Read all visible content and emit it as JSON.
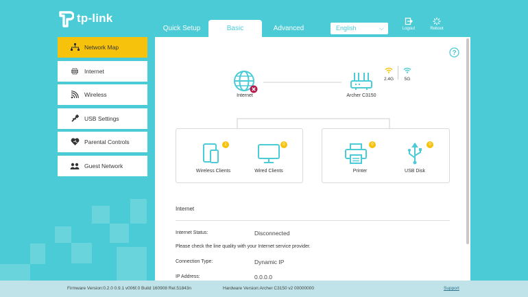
{
  "brand": {
    "name": "tp-link"
  },
  "tabs": [
    {
      "label": "Quick Setup"
    },
    {
      "label": "Basic"
    },
    {
      "label": "Advanced"
    }
  ],
  "language": {
    "selected": "English"
  },
  "top_buttons": {
    "logout": "Logout",
    "reboot": "Reboot"
  },
  "sidebar": {
    "items": [
      {
        "label": "Network Map",
        "icon": "network-map-icon"
      },
      {
        "label": "Internet",
        "icon": "globe-icon"
      },
      {
        "label": "Wireless",
        "icon": "wifi-icon"
      },
      {
        "label": "USB Settings",
        "icon": "usb-icon"
      },
      {
        "label": "Parental Controls",
        "icon": "heart-icon"
      },
      {
        "label": "Guest Network",
        "icon": "users-icon"
      }
    ]
  },
  "map": {
    "internet_label": "Internet",
    "router_label": "Archer C3150",
    "band_24": "2.4G",
    "band_5": "5G",
    "wireless_clients": {
      "label": "Wireless Clients",
      "count": "1"
    },
    "wired_clients": {
      "label": "Wired Clients",
      "count": "0"
    },
    "printer": {
      "label": "Printer",
      "count": "0"
    },
    "usb_disk": {
      "label": "USB Disk",
      "count": "0"
    }
  },
  "internet_section": {
    "title": "Internet",
    "status_label": "Internet Status:",
    "status_value": "Disconnected",
    "note": "Please check the line quality with your Internet service provider.",
    "conn_type_label": "Connection Type:",
    "conn_type_value": "Dynamic IP",
    "ip_label": "IP Address:",
    "ip_value": "0.0.0.0"
  },
  "footer": {
    "firmware": "Firmware Version:0.2.0 0.9.1 v006f.0 Build 160908 Rel.51843n",
    "hardware": "Hardware Version:Archer C3150 v2 00000000",
    "support": "Support"
  },
  "colors": {
    "accent": "#4acbd6",
    "active": "#f7c20b",
    "status_error": "#b5184c"
  }
}
